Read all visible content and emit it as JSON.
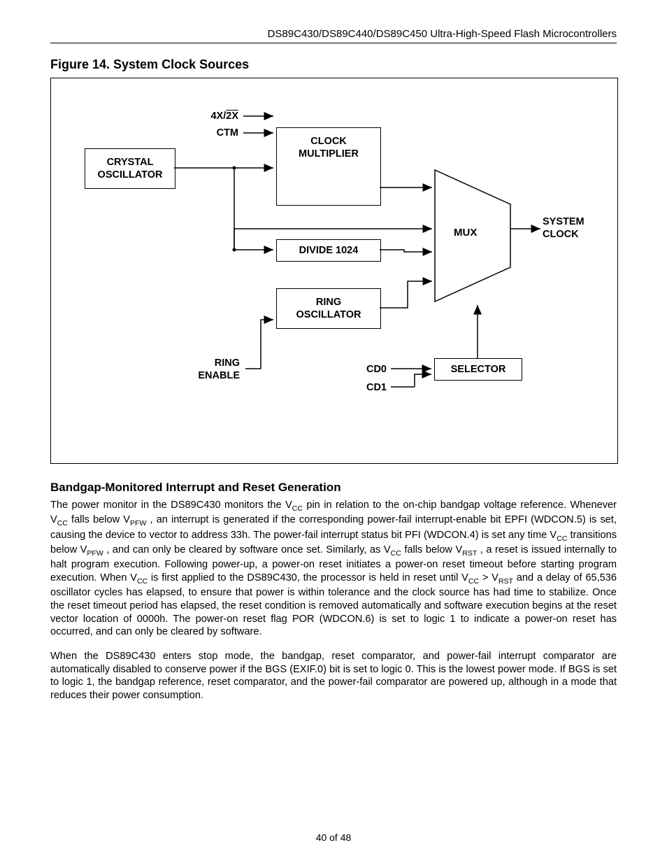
{
  "header": "DS89C430/DS89C440/DS89C450 Ultra-High-Speed Flash Microcontrollers",
  "figTitle": "Figure 14. System Clock Sources",
  "dg": {
    "crystal_l1": "CRYSTAL",
    "crystal_l2": "OSCILLATOR",
    "clkmul_l1": "CLOCK",
    "clkmul_l2": "MULTIPLIER",
    "divide": "DIVIDE 1024",
    "ringosc_l1": "RING",
    "ringosc_l2": "OSCILLATOR",
    "selector": "SELECTOR",
    "mux": "MUX",
    "sysclk_l1": "SYSTEM",
    "sysclk_l2": "CLOCK",
    "x4": "4X/",
    "x2ov": "2X",
    "ctm": "CTM",
    "ringen_l1": "RING",
    "ringen_l2": "ENABLE",
    "cd0": "CD0",
    "cd1": "CD1"
  },
  "secTitle": "Bandgap-Monitored Interrupt and Reset Generation",
  "p1a": "The power monitor in the DS89C430 monitors the V",
  "p1b": " pin in relation to the on-chip bandgap voltage reference. Whenever V",
  "p1c": " falls below V",
  "p1d": ", an interrupt is generated if the corresponding power-fail interrupt-enable bit EPFI (WDCON.5) is set, causing the device to vector to address 33h. The power-fail interrupt status bit PFI (WDCON.4) is set any time V",
  "p1e": " transitions below V",
  "p1f": ", and can only be cleared by software once set. Similarly, as V",
  "p1g": " falls below V",
  "p1h": ", a reset is issued internally to halt program execution. Following power-up, a power-on reset initiates a power-on reset timeout before starting program execution. When V",
  "p1i": " is first applied to the DS89C430, the processor is held in reset until V",
  "p1j": " &gt; V",
  "p1k": " and a delay of 65,536 oscillator cycles has elapsed, to ensure that power is within tolerance and the clock source has had time to stabilize. Once the reset timeout period has elapsed, the reset condition is removed automatically and software execution begins at the reset vector location of 0000h. The power-on reset flag POR (WDCON.6) is set to logic 1 to indicate a power-on reset has occurred, and can only be cleared by software.",
  "p2": "When the DS89C430 enters stop mode, the bandgap, reset comparator, and power-fail interrupt comparator are automatically disabled to conserve power if the BGS (EXIF.0) bit is set to logic 0. This is the lowest power mode. If BGS is set to logic 1, the bandgap reference, reset comparator, and the power-fail comparator are powered up, although in a mode that reduces their power consumption.",
  "sub_cc": "CC",
  "sub_pfw": "PFW",
  "sub_rst": "RST",
  "footer": "40 of 48"
}
